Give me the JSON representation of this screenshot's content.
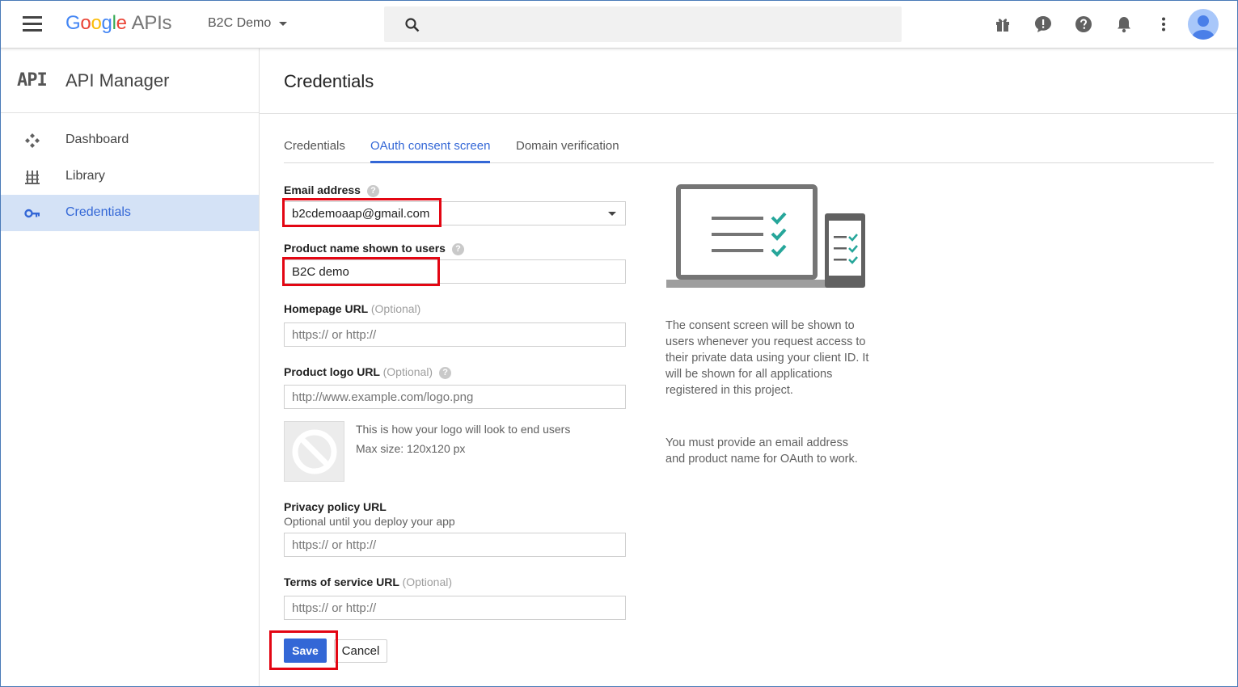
{
  "header": {
    "logo_letters": [
      "G",
      "o",
      "o",
      "g",
      "l",
      "e"
    ],
    "logo_suffix": "APIs",
    "project_name": "B2C Demo",
    "icons": [
      "menu-icon",
      "search-icon",
      "gift-icon",
      "feedback-icon",
      "help-icon",
      "notifications-icon",
      "more-vert-icon",
      "account-avatar-icon"
    ]
  },
  "sidebar": {
    "badge": "API",
    "title": "API Manager",
    "items": [
      {
        "label": "Dashboard",
        "icon": "dashboard-icon",
        "active": false
      },
      {
        "label": "Library",
        "icon": "library-icon",
        "active": false
      },
      {
        "label": "Credentials",
        "icon": "key-icon",
        "active": true
      }
    ]
  },
  "page": {
    "title": "Credentials",
    "tabs": [
      {
        "label": "Credentials",
        "active": false
      },
      {
        "label": "OAuth consent screen",
        "active": true
      },
      {
        "label": "Domain verification",
        "active": false
      }
    ]
  },
  "form": {
    "email_label": "Email address",
    "email_value": "b2cdemoaap@gmail.com",
    "product_label": "Product name shown to users",
    "product_value": "B2C demo",
    "homepage_label": "Homepage URL",
    "homepage_optional": "(Optional)",
    "homepage_placeholder": "https:// or http://",
    "logo_label": "Product logo URL",
    "logo_optional": "(Optional)",
    "logo_placeholder": "http://www.example.com/logo.png",
    "logo_note_1": "This is how your logo will look to end users",
    "logo_note_2": "Max size: 120x120 px",
    "privacy_label": "Privacy policy URL",
    "privacy_sub": "Optional until you deploy your app",
    "privacy_placeholder": "https:// or http://",
    "tos_label": "Terms of service URL",
    "tos_optional": "(Optional)",
    "tos_placeholder": "https:// or http://",
    "save_label": "Save",
    "cancel_label": "Cancel"
  },
  "info": {
    "para1": "The consent screen will be shown to users whenever you request access to their private data using your client ID. It will be shown for all applications registered in this project.",
    "para2": "You must provide an email address and product name for OAuth to work."
  },
  "colors": {
    "accent": "#3367d6",
    "active_nav_bg": "#d4e2f6",
    "highlight_red": "#e30613",
    "check_teal": "#26a69a"
  }
}
